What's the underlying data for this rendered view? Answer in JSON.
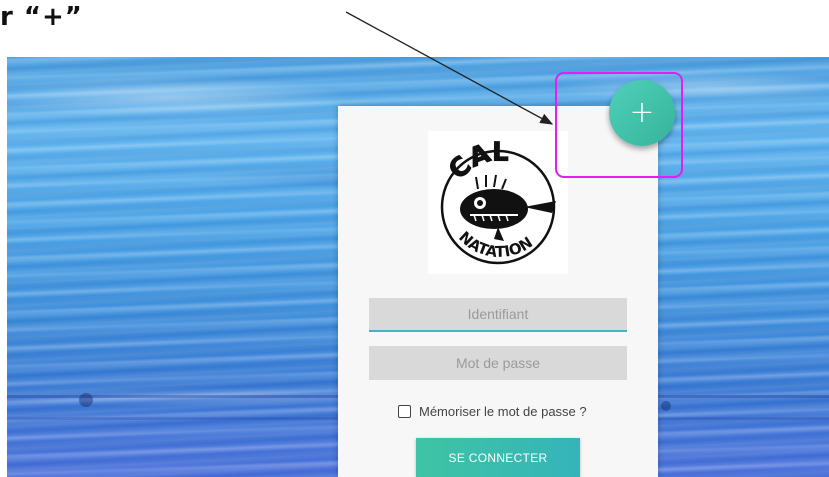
{
  "caption": "r “+”",
  "login": {
    "username_placeholder": "Identifiant",
    "password_placeholder": "Mot de passe",
    "remember_label": "Mémoriser le mot de passe ?",
    "connect_label": "SE CONNECTER"
  },
  "fab": {
    "label": "+"
  },
  "logo": {
    "top_text": "CAL",
    "bottom_text": "NATATION"
  },
  "colors": {
    "accent": "#3ec4a5",
    "highlight": "#e81cf0",
    "field_focus": "#45b2c8"
  }
}
